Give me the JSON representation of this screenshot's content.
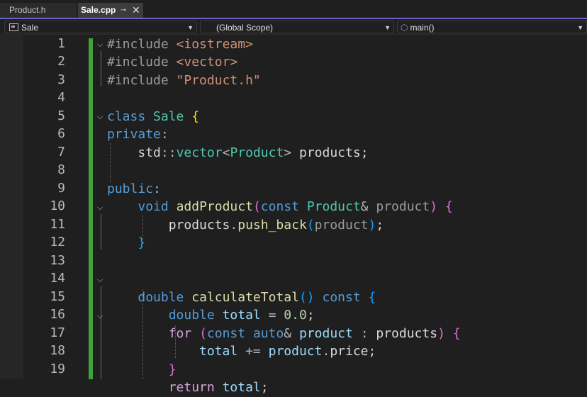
{
  "tabs": [
    {
      "label": "Product.h",
      "active": false
    },
    {
      "label": "Sale.cpp",
      "active": true
    }
  ],
  "tab_icons": {
    "pin": "pin-icon",
    "close": "close-icon"
  },
  "navbar": {
    "project": "Sale",
    "scope": "(Global Scope)",
    "member": "main()"
  },
  "line_numbers": [
    "1",
    "2",
    "3",
    "4",
    "5",
    "6",
    "7",
    "8",
    "9",
    "10",
    "11",
    "12",
    "13",
    "14",
    "15",
    "16",
    "17",
    "18",
    "19"
  ],
  "code_lines": [
    "#include <iostream>",
    "#include <vector>",
    "#include \"Product.h\"",
    "",
    "class Sale {",
    "private:",
    "    std::vector<Product> products;",
    "",
    "public:",
    "    void addProduct(const Product& product) {",
    "        products.push_back(product);",
    "    }",
    "",
    "    double calculateTotal() const {",
    "        double total = 0.0;",
    "        for (const auto& product : products) {",
    "            total += product.price;",
    "        }",
    "        return total;"
  ],
  "colors": {
    "accent": "#7061c8",
    "change_bar": "#3fa33a",
    "keyword": "#569cd6",
    "type": "#4ec9b0",
    "function": "#dcdcaa",
    "string": "#ce9178",
    "variable": "#9cdcfe",
    "number": "#b5cea8"
  }
}
